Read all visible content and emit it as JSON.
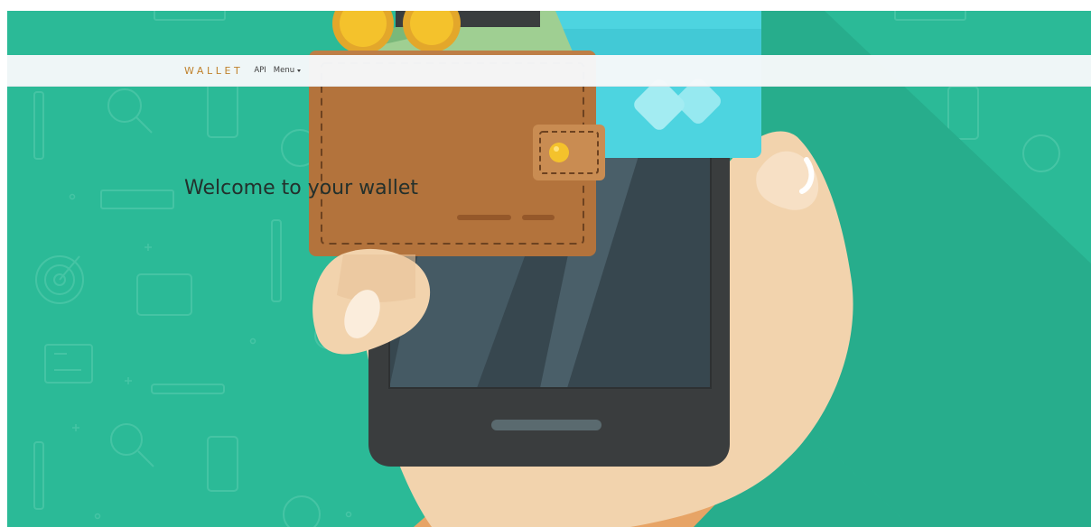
{
  "navbar": {
    "brand": "WALLET",
    "links": [
      {
        "label": "API"
      },
      {
        "label": "Menu"
      }
    ]
  },
  "hero": {
    "heading": "Welcome to your wallet",
    "background_color": "#2bba97"
  },
  "colors": {
    "brand": "#c0822d",
    "hero_bg": "#2bba97",
    "wallet": "#b3733c",
    "card": "#4dd4e0",
    "phone": "#3a3d3e",
    "hand": "#f2d3ad"
  },
  "icons": [
    "magnifier-icon",
    "pencil-icon",
    "tablet-icon",
    "ruler-icon",
    "chat-bubble-icon",
    "target-icon",
    "id-card-icon"
  ]
}
